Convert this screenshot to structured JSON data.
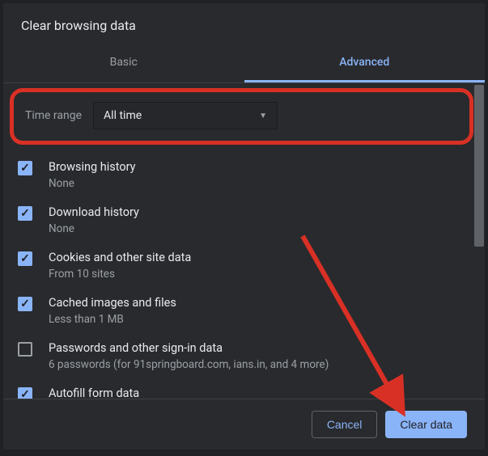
{
  "title": "Clear browsing data",
  "tabs": {
    "basic": "Basic",
    "advanced": "Advanced"
  },
  "time_range": {
    "label": "Time range",
    "value": "All time"
  },
  "options": [
    {
      "checked": true,
      "title": "Browsing history",
      "subtitle": "None"
    },
    {
      "checked": true,
      "title": "Download history",
      "subtitle": "None"
    },
    {
      "checked": true,
      "title": "Cookies and other site data",
      "subtitle": "From 10 sites"
    },
    {
      "checked": true,
      "title": "Cached images and files",
      "subtitle": "Less than 1 MB"
    },
    {
      "checked": false,
      "title": "Passwords and other sign-in data",
      "subtitle": "6 passwords (for 91springboard.com, ians.in, and 4 more)"
    },
    {
      "checked": true,
      "title": "Autofill form data",
      "subtitle": ""
    }
  ],
  "buttons": {
    "cancel": "Cancel",
    "clear": "Clear data"
  }
}
